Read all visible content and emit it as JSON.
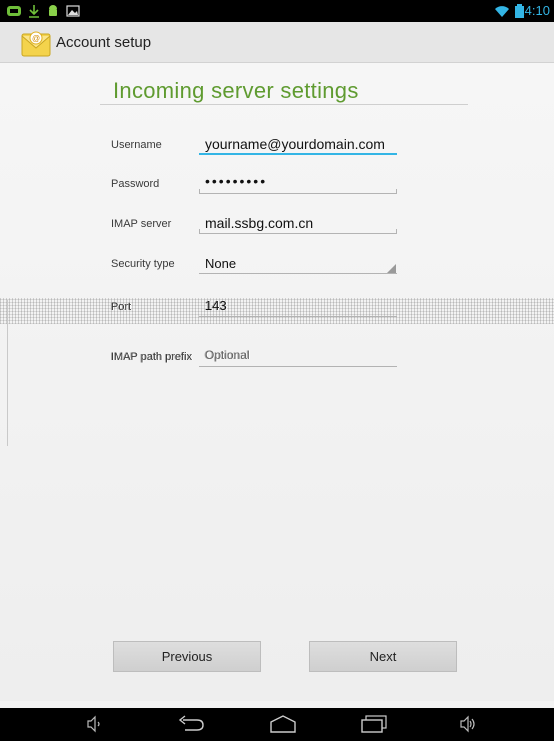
{
  "status_bar": {
    "time": "14:10",
    "icons": [
      "notification-icon",
      "download-icon",
      "android-icon",
      "image-icon",
      "wifi-icon",
      "battery-icon"
    ]
  },
  "action_bar": {
    "title": "Account setup",
    "icon": "email-app-icon"
  },
  "form": {
    "heading": "Incoming server settings",
    "fields": [
      {
        "label": "Username",
        "value": "yourname@yourdomain.com"
      },
      {
        "label": "Password",
        "value": "•••••••••"
      },
      {
        "label": "IMAP server",
        "value": "mail.ssbg.com.cn"
      },
      {
        "label": "Security type",
        "value": "None"
      },
      {
        "label": "Port",
        "value": "143"
      },
      {
        "label": "IMAP path prefix",
        "value": "",
        "placeholder": "Optional"
      }
    ]
  },
  "buttons": {
    "previous": "Previous",
    "next": "Next"
  },
  "nav_bar": {
    "icons": [
      "volume-down-icon",
      "back-icon",
      "home-icon",
      "recent-apps-icon",
      "volume-up-icon"
    ]
  },
  "colors": {
    "accent": "#33b5e5",
    "heading": "#5f9b30",
    "status_bar_bg": "#000000"
  }
}
